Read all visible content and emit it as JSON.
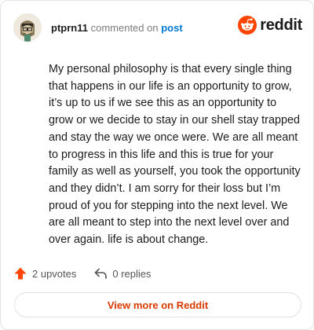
{
  "header": {
    "username": "ptprn11",
    "action": "commented on",
    "post_link": "post",
    "brand_name": "reddit",
    "brand_color": "#ff4500"
  },
  "comment": {
    "text": "My personal philosophy is that every single thing that happens in our life is an opportunity to grow, it’s up to us if we see this as an opportunity to grow or we decide to stay in our shell stay trapped and stay the way we once were. We are all meant to progress in this life and this is true for your family as well as yourself, you took the opportunity and they didn’t. I am sorry for their loss but I’m proud of you for stepping into the next level. We are all meant to step into the next level over and over again. life is about change."
  },
  "stats": {
    "upvotes": "2 upvotes",
    "replies": "0 replies",
    "upvote_icon": "upvote-arrow-icon",
    "reply_icon": "reply-arrow-icon"
  },
  "cta": {
    "label": "View more on Reddit",
    "color": "#d93a00"
  }
}
